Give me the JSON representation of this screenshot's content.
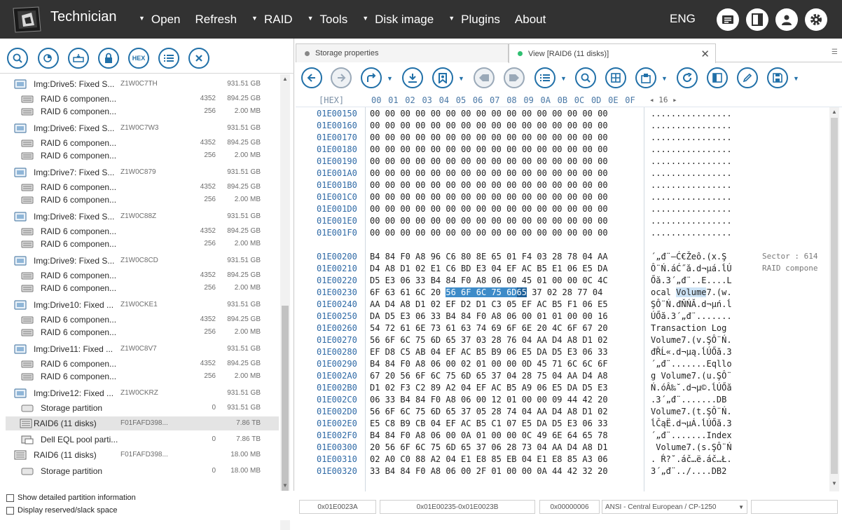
{
  "app": {
    "title": "Technician",
    "language": "ENG"
  },
  "menu": [
    {
      "label": "Open",
      "dropdown": true
    },
    {
      "label": "Refresh",
      "dropdown": false
    },
    {
      "label": "RAID",
      "dropdown": true
    },
    {
      "label": "Tools",
      "dropdown": true
    },
    {
      "label": "Disk image",
      "dropdown": true
    },
    {
      "label": "Plugins",
      "dropdown": true
    },
    {
      "label": "About",
      "dropdown": false
    }
  ],
  "left_toolbar": {
    "hex_label": "HEX"
  },
  "tree": [
    {
      "type": "disk",
      "name": "Img:Drive5: Fixed S...",
      "id": "Z1W0C7TH",
      "count": "",
      "size": "931.51 GB"
    },
    {
      "type": "part",
      "name": "RAID 6 componen...",
      "id": "",
      "count": "4352",
      "size": "894.25 GB"
    },
    {
      "type": "part",
      "name": "RAID 6 componen...",
      "id": "",
      "count": "256",
      "size": "2.00 MB"
    },
    {
      "type": "disk",
      "name": "Img:Drive6: Fixed S...",
      "id": "Z1W0C7W3",
      "count": "",
      "size": "931.51 GB"
    },
    {
      "type": "part",
      "name": "RAID 6 componen...",
      "id": "",
      "count": "4352",
      "size": "894.25 GB"
    },
    {
      "type": "part",
      "name": "RAID 6 componen...",
      "id": "",
      "count": "256",
      "size": "2.00 MB"
    },
    {
      "type": "disk",
      "name": "Img:Drive7: Fixed S...",
      "id": "Z1W0C879",
      "count": "",
      "size": "931.51 GB"
    },
    {
      "type": "part",
      "name": "RAID 6 componen...",
      "id": "",
      "count": "4352",
      "size": "894.25 GB"
    },
    {
      "type": "part",
      "name": "RAID 6 componen...",
      "id": "",
      "count": "256",
      "size": "2.00 MB"
    },
    {
      "type": "disk",
      "name": "Img:Drive8: Fixed S...",
      "id": "Z1W0C88Z",
      "count": "",
      "size": "931.51 GB"
    },
    {
      "type": "part",
      "name": "RAID 6 componen...",
      "id": "",
      "count": "4352",
      "size": "894.25 GB"
    },
    {
      "type": "part",
      "name": "RAID 6 componen...",
      "id": "",
      "count": "256",
      "size": "2.00 MB"
    },
    {
      "type": "disk",
      "name": "Img:Drive9: Fixed S...",
      "id": "Z1W0C8CD",
      "count": "",
      "size": "931.51 GB"
    },
    {
      "type": "part",
      "name": "RAID 6 componen...",
      "id": "",
      "count": "4352",
      "size": "894.25 GB"
    },
    {
      "type": "part",
      "name": "RAID 6 componen...",
      "id": "",
      "count": "256",
      "size": "2.00 MB"
    },
    {
      "type": "disk",
      "name": "Img:Drive10: Fixed ...",
      "id": "Z1W0CKE1",
      "count": "",
      "size": "931.51 GB"
    },
    {
      "type": "part",
      "name": "RAID 6 componen...",
      "id": "",
      "count": "4352",
      "size": "894.25 GB"
    },
    {
      "type": "part",
      "name": "RAID 6 componen...",
      "id": "",
      "count": "256",
      "size": "2.00 MB"
    },
    {
      "type": "disk",
      "name": "Img:Drive11: Fixed ...",
      "id": "Z1W0C8V7",
      "count": "",
      "size": "931.51 GB"
    },
    {
      "type": "part",
      "name": "RAID 6 componen...",
      "id": "",
      "count": "4352",
      "size": "894.25 GB"
    },
    {
      "type": "part",
      "name": "RAID 6 componen...",
      "id": "",
      "count": "256",
      "size": "2.00 MB"
    },
    {
      "type": "disk",
      "name": "Img:Drive12: Fixed ...",
      "id": "Z1W0CKRZ",
      "count": "",
      "size": "931.51 GB"
    },
    {
      "type": "storage",
      "name": "Storage partition",
      "id": "",
      "count": "0",
      "size": "931.51 GB"
    },
    {
      "type": "raid",
      "name": "RAID6 (11 disks)",
      "id": "F01FAFD398...",
      "count": "",
      "size": "7.86 TB",
      "selected": true
    },
    {
      "type": "pool",
      "name": "Dell EQL pool parti...",
      "id": "",
      "count": "0",
      "size": "7.86 TB"
    },
    {
      "type": "raid",
      "name": "RAID6 (11 disks)",
      "id": "F01FAFD398...",
      "count": "",
      "size": "18.00 MB"
    },
    {
      "type": "storage",
      "name": "Storage partition",
      "id": "",
      "count": "0",
      "size": "18.00 MB"
    }
  ],
  "left_footer": {
    "show_detailed": "Show detailed partition information",
    "display_reserved": "Display reserved/slack space"
  },
  "tabs": [
    {
      "label": "Storage properties",
      "active": false
    },
    {
      "label": "View [RAID6 (11 disks)]",
      "active": true
    }
  ],
  "hex_header": {
    "label": "[HEX]",
    "columns": [
      "00",
      "01",
      "02",
      "03",
      "04",
      "05",
      "06",
      "07",
      "08",
      "09",
      "0A",
      "0B",
      "0C",
      "0D",
      "0E",
      "0F"
    ],
    "width_label": "16"
  },
  "hex_rows": [
    {
      "addr": "01E00150",
      "hex": "00 00 00 00 00 00 00 00 00 00 00 00 00 00 00 00",
      "ascii": "................"
    },
    {
      "addr": "01E00160",
      "hex": "00 00 00 00 00 00 00 00 00 00 00 00 00 00 00 00",
      "ascii": "................"
    },
    {
      "addr": "01E00170",
      "hex": "00 00 00 00 00 00 00 00 00 00 00 00 00 00 00 00",
      "ascii": "................"
    },
    {
      "addr": "01E00180",
      "hex": "00 00 00 00 00 00 00 00 00 00 00 00 00 00 00 00",
      "ascii": "................"
    },
    {
      "addr": "01E00190",
      "hex": "00 00 00 00 00 00 00 00 00 00 00 00 00 00 00 00",
      "ascii": "................"
    },
    {
      "addr": "01E001A0",
      "hex": "00 00 00 00 00 00 00 00 00 00 00 00 00 00 00 00",
      "ascii": "................"
    },
    {
      "addr": "01E001B0",
      "hex": "00 00 00 00 00 00 00 00 00 00 00 00 00 00 00 00",
      "ascii": "................"
    },
    {
      "addr": "01E001C0",
      "hex": "00 00 00 00 00 00 00 00 00 00 00 00 00 00 00 00",
      "ascii": "................"
    },
    {
      "addr": "01E001D0",
      "hex": "00 00 00 00 00 00 00 00 00 00 00 00 00 00 00 00",
      "ascii": "................"
    },
    {
      "addr": "01E001E0",
      "hex": "00 00 00 00 00 00 00 00 00 00 00 00 00 00 00 00",
      "ascii": "................"
    },
    {
      "addr": "01E001F0",
      "hex": "00 00 00 00 00 00 00 00 00 00 00 00 00 00 00 00",
      "ascii": "................"
    },
    {
      "addr": "",
      "hex": "",
      "ascii": "",
      "gap": true
    },
    {
      "addr": "01E00200",
      "hex": "B4 84 F0 A8 96 C6 80 8E 65 01 F4 03 28 78 04 AA",
      "ascii": "´„đ¨–Ć€Žeô.(x.Ş",
      "note": "Sector : 614"
    },
    {
      "addr": "01E00210",
      "hex": "D4 A8 D1 02 E1 C6 BD E3 04 EF AC B5 E1 06 E5 DA",
      "ascii": "Ô¨Ń.áĆ˝ă.d¬µá.ĺÚ",
      "note": "RAID compone"
    },
    {
      "addr": "01E00220",
      "hex": "D5 E3 06 33 B4 84 F0 A8 06 00 45 01 00 00 0C 4C",
      "ascii": "Őă.3´„đ¨..E....L"
    },
    {
      "addr": "01E00230",
      "hex_pre": "6F 63 61 6C 20 ",
      "hex_hl": "56 6F 6C 75 6D",
      "hex_hl2": "65",
      "hex_post": " 37 02 28 77 04",
      "ascii_pre": "ocal ",
      "ascii_hl": "Volume",
      "ascii_post": "7.(w."
    },
    {
      "addr": "01E00240",
      "hex": "AA D4 A8 D1 02 EF D2 D1 C3 05 EF AC B5 F1 06 E5",
      "ascii": "ŞÔ¨Ń.đŇŃĂ.d¬µń.ĺ"
    },
    {
      "addr": "01E00250",
      "hex": "DA D5 E3 06 33 B4 84 F0 A8 06 00 01 01 00 00 16",
      "ascii": "ÚŐă.3´„đ¨......."
    },
    {
      "addr": "01E00260",
      "hex": "54 72 61 6E 73 61 63 74 69 6F 6E 20 4C 6F 67 20",
      "ascii": "Transaction Log "
    },
    {
      "addr": "01E00270",
      "hex": "56 6F 6C 75 6D 65 37 03 28 76 04 AA D4 A8 D1 02",
      "ascii": "Volume7.(v.ŞÔ¨Ń."
    },
    {
      "addr": "01E00280",
      "hex": "EF D8 C5 AB 04 EF AC B5 B9 06 E5 DA D5 E3 06 33",
      "ascii": "đŘĹ«.d¬µą.ĺÚŐă.3"
    },
    {
      "addr": "01E00290",
      "hex": "B4 84 F0 A8 06 00 02 01 00 00 0D 45 71 6C 6C 6F",
      "ascii": "´„đ¨.......Eqllo"
    },
    {
      "addr": "01E002A0",
      "hex": "67 20 56 6F 6C 75 6D 65 37 04 28 75 04 AA D4 A8",
      "ascii": "g Volume7.(u.ŞÔ¨"
    },
    {
      "addr": "01E002B0",
      "hex": "D1 02 F3 C2 89 A2 04 EF AC B5 A9 06 E5 DA D5 E3",
      "ascii": "Ń.óÂ‰˘.d¬µ©.ĺÚŐă"
    },
    {
      "addr": "01E002C0",
      "hex": "06 33 B4 84 F0 A8 06 00 12 01 00 00 09 44 42 20",
      "ascii": ".3´„đ¨.......DB "
    },
    {
      "addr": "01E002D0",
      "hex": "56 6F 6C 75 6D 65 37 05 28 74 04 AA D4 A8 D1 02",
      "ascii": "Volume7.(t.ŞÔ¨Ń."
    },
    {
      "addr": "01E002E0",
      "hex": "E5 C8 B9 CB 04 EF AC B5 C1 07 E5 DA D5 E3 06 33",
      "ascii": "ĺČąË.d¬µÁ.ĺÚŐă.3"
    },
    {
      "addr": "01E002F0",
      "hex": "B4 84 F0 A8 06 00 0A 01 00 00 0C 49 6E 64 65 78",
      "ascii": "´„đ¨.......Index"
    },
    {
      "addr": "01E00300",
      "hex": "20 56 6F 6C 75 6D 65 37 06 28 73 04 AA D4 A8 D1",
      "ascii": " Volume7.(s.ŞÔ¨Ń"
    },
    {
      "addr": "01E00310",
      "hex": "02 A0 C0 88 A2 04 E1 E8 85 EB 04 E1 E8 85 A3 06",
      "ascii": ". Ŕ?˘.áč…ë.áč…Ł."
    },
    {
      "addr": "01E00320",
      "hex": "33 B4 84 F0 A8 06 00 2F 01 00 00 0A 44 42 32 20",
      "ascii": "3´„đ¨../....DB2 "
    }
  ],
  "status": {
    "offset": "0x01E0023A",
    "range": "0x01E00235-0x01E0023B",
    "length": "0x00000006",
    "encoding": "ANSI - Central European / CP-1250"
  }
}
